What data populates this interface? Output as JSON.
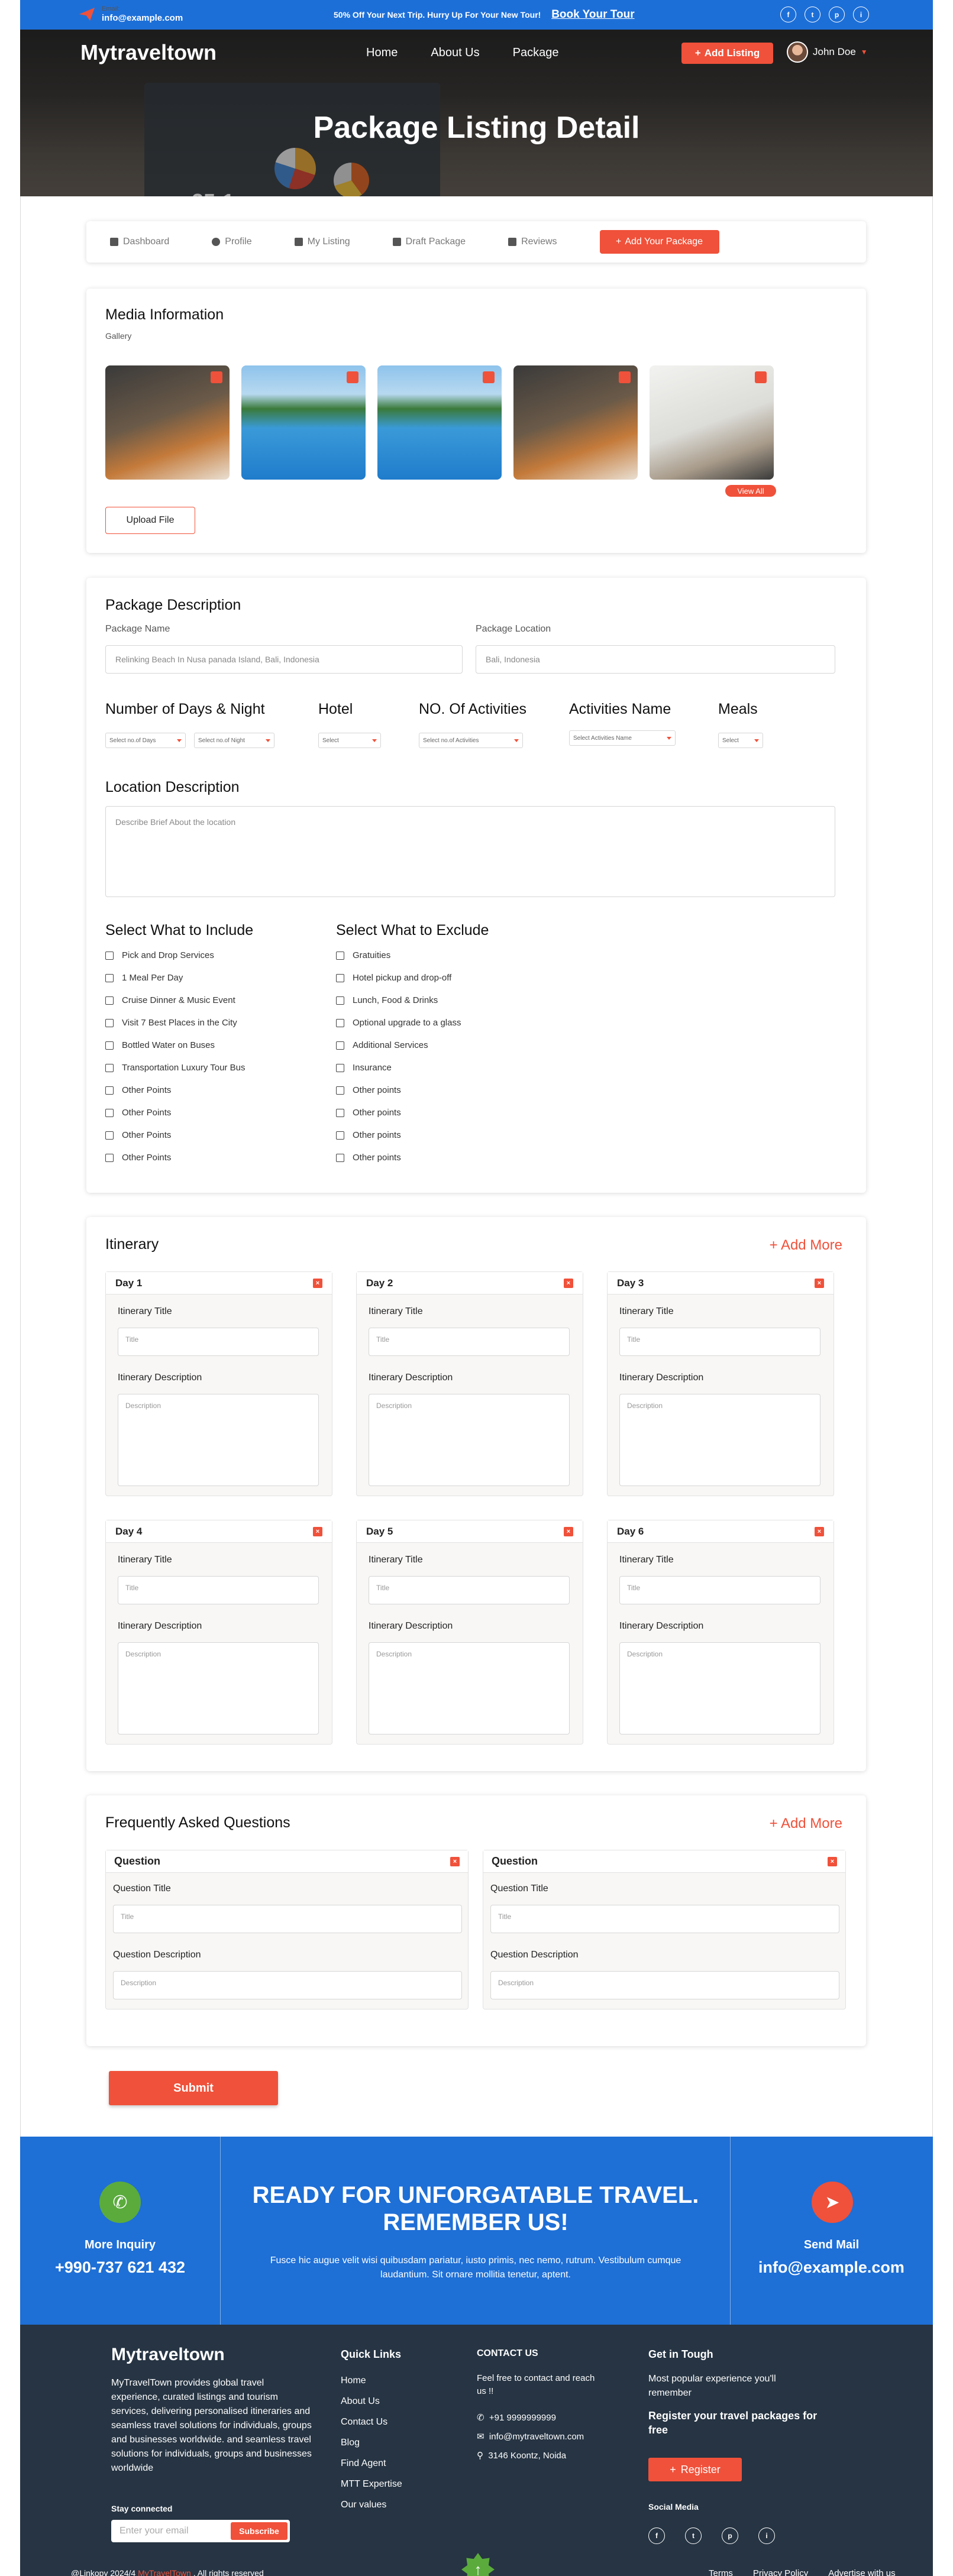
{
  "topbar": {
    "email_label": "Email:",
    "email": "info@example.com",
    "promo": "50% Off Your Next Trip. Hurry Up For Your New Tour!",
    "promo_link": "Book Your Tour",
    "social": [
      "f",
      "t",
      "p",
      "i"
    ]
  },
  "nav": {
    "logo": "Mytraveltown",
    "links": [
      "Home",
      "About Us",
      "Package"
    ],
    "add_listing": "Add Listing",
    "user": "John Doe"
  },
  "hero": {
    "title": "Package Listing Detail",
    "overlay_number": "25:1"
  },
  "tabs": {
    "items": [
      "Dashboard",
      "Profile",
      "My Listing",
      "Draft Package",
      "Reviews"
    ],
    "add": "Add Your Package"
  },
  "media": {
    "title": "Media Information",
    "gallery": "Gallery",
    "view_all": "View All",
    "upload": "Upload File"
  },
  "package": {
    "title": "Package Description",
    "name_label": "Package Name",
    "name_value": "Relinking Beach In Nusa panada Island, Bali, Indonesia",
    "location_label": "Package Location",
    "location_value": "Bali, Indonesia",
    "days_label": "Number of Days & Night",
    "days_ph": "Select no.of Days",
    "night_ph": "Select no.of Night",
    "hotel_label": "Hotel",
    "hotel_ph": "Select",
    "activities_label": "NO. Of Activities",
    "activities_ph": "Select no.of Activities",
    "act_name_label": "Activities Name",
    "act_name_ph": "Select Activities Name",
    "meals_label": "Meals",
    "meals_ph": "Select",
    "loc_desc_label": "Location Description",
    "loc_desc_ph": "Describe Brief About the location",
    "include_title": "Select What to Include",
    "include": [
      "Pick and Drop Services",
      "1 Meal Per Day",
      "Cruise Dinner & Music Event",
      "Visit 7 Best Places in the City",
      "Bottled Water on Buses",
      "Transportation Luxury Tour Bus",
      "Other Points",
      "Other Points",
      "Other Points",
      "Other Points"
    ],
    "exclude_title": "Select What to Exclude",
    "exclude": [
      "Gratuities",
      "Hotel pickup and drop-off",
      "Lunch, Food & Drinks",
      "Optional upgrade to a glass",
      "Additional Services",
      "Insurance",
      "Other points",
      "Other points",
      "Other points",
      "Other points"
    ]
  },
  "itinerary": {
    "title": "Itinerary",
    "add_more": "Add More",
    "title_label": "Itinerary Title",
    "title_ph": "Title",
    "desc_label": "Itinerary Description",
    "desc_ph": "Description",
    "days": [
      "Day 1",
      "Day 2",
      "Day 3",
      "Day 4",
      "Day 5",
      "Day 6"
    ]
  },
  "faq": {
    "title": "Frequently Asked Questions",
    "add_more": "Add More",
    "card": "Question",
    "q_title": "Question Title",
    "q_ph": "Title",
    "q_desc": "Question Description",
    "q_desc_ph": "Description"
  },
  "submit": "Submit",
  "cta": {
    "left_label": "More Inquiry",
    "phone": "+990-737 621 432",
    "heading": "READY FOR UNFORGATABLE TRAVEL. REMEMBER US!",
    "sub": "Fusce hic augue velit wisi quibusdam pariatur, iusto primis, nec nemo, rutrum. Vestibulum cumque laudantium. Sit ornare mollitia tenetur, aptent.",
    "right_label": "Send Mail",
    "email": "info@example.com"
  },
  "footer": {
    "logo": "Mytraveltown",
    "desc": "MyTravelTown provides global travel experience, curated listings and tourism services, delivering personalised itineraries and seamless travel solutions for individuals, groups and businesses worldwide.  and seamless travel solutions for individuals, groups and businesses worldwide",
    "stay": "Stay connected",
    "email_ph": "Enter your email",
    "subscribe": "Subscribe",
    "quick_title": "Quick Links",
    "quick": [
      "Home",
      "About Us",
      "Contact Us",
      "Blog",
      "Find Agent",
      "MTT Expertise",
      "Our values"
    ],
    "contact_title": "CONTACT US",
    "contact_text": "Feel free to contact and reach us !!",
    "phone": "+91 9999999999",
    "email": "info@mytraveltown.com",
    "address": "3146 Koontz, Noida",
    "touch_title": "Get in Tough",
    "touch_text": "Most popular experience you'll remember",
    "touch_cta": "Register your travel packages for free",
    "register": "Register",
    "social_title": "Social Media",
    "copy_prefix": "@Linkopy 2024/4",
    "copy_brand": "MyTravelTown",
    "copy_suffix": ", All rights reserved",
    "bottom_links": [
      "Terms",
      "Privacy Policy",
      "Advertise with us"
    ]
  }
}
